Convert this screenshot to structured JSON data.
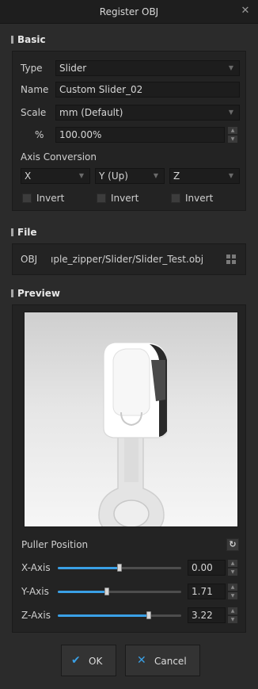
{
  "window": {
    "title": "Register OBJ",
    "close_icon": "close-icon"
  },
  "basic": {
    "heading": "Basic",
    "type_label": "Type",
    "type_value": "Slider",
    "name_label": "Name",
    "name_value": "Custom Slider_02",
    "scale_label": "Scale",
    "scale_value": "mm (Default)",
    "percent_label": "%",
    "percent_value": "100.00%",
    "axis_heading": "Axis Conversion",
    "axes": [
      {
        "value": "X",
        "invert_label": "Invert"
      },
      {
        "value": "Y (Up)",
        "invert_label": "Invert"
      },
      {
        "value": "Z",
        "invert_label": "Invert"
      }
    ]
  },
  "file": {
    "heading": "File",
    "obj_label": "OBJ",
    "obj_value": "ıple_zipper/Slider/Slider_Test.obj"
  },
  "preview": {
    "heading": "Preview",
    "puller_label": "Puller Position",
    "axes": [
      {
        "label": "X-Axis",
        "value": "0.00",
        "position": 0.5
      },
      {
        "label": "Y-Axis",
        "value": "1.71",
        "position": 0.4
      },
      {
        "label": "Z-Axis",
        "value": "3.22",
        "position": 0.74
      }
    ]
  },
  "buttons": {
    "ok_label": "OK",
    "cancel_label": "Cancel"
  },
  "colors": {
    "accent": "#3aa0e6",
    "background": "#2b2b2b"
  }
}
